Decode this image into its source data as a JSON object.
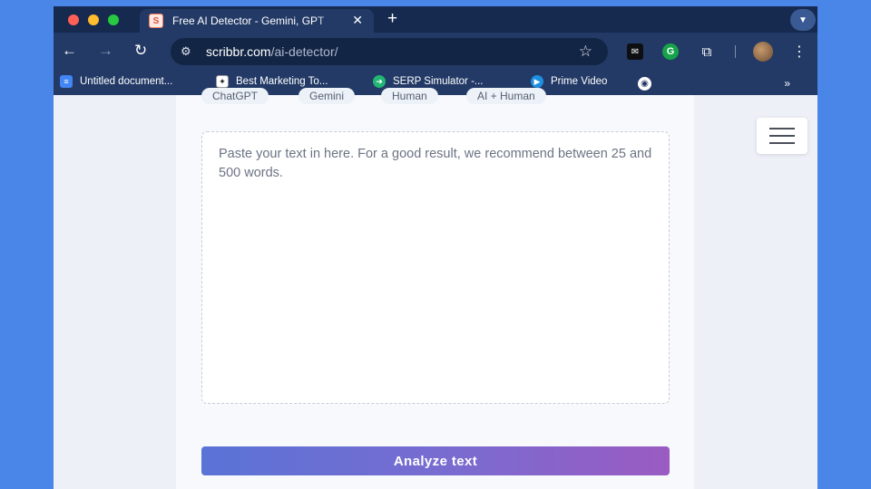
{
  "browser": {
    "tab": {
      "title": "Free AI Detector - Gemini, GPT",
      "favicon": "scribbr-favicon",
      "close_icon": "✕"
    },
    "new_tab_icon": "+",
    "address_bar": {
      "domain": "scribbr.com",
      "path": "/ai-detector/"
    },
    "bookmarks": [
      {
        "label": "Untitled document...",
        "icon": "docs-icon"
      },
      {
        "label": "Best Marketing To...",
        "icon": "marketing-icon"
      },
      {
        "label": "SERP Simulator -...",
        "icon": "serp-icon"
      },
      {
        "label": "Prime Video",
        "icon": "prime-video-icon"
      }
    ],
    "bookmarks_more": "»"
  },
  "page": {
    "chips": [
      "ChatGPT",
      "Gemini",
      "Human",
      "AI + Human"
    ],
    "textarea": {
      "placeholder": "Paste your text in here. For a good result, we recommend between 25 and 500 words."
    },
    "analyze_button": "Analyze text"
  },
  "colors": {
    "outer_background": "#4a86e8",
    "browser_chrome": "#233a66",
    "button_gradient_start": "#5a73d6",
    "button_gradient_end": "#9a5bc2"
  }
}
